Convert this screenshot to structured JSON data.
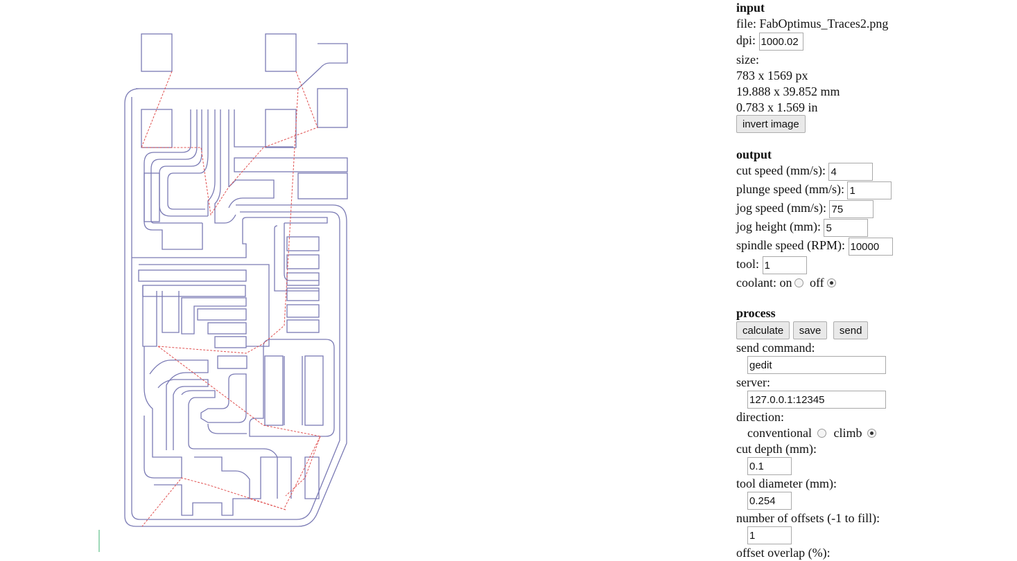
{
  "input": {
    "title": "input",
    "file_label": "file:",
    "file_name": "FabOptimus_Traces2.png",
    "dpi_label": "dpi:",
    "dpi_value": "1000.02",
    "size_label": "size:",
    "size_px": "783 x 1569 px",
    "size_mm": "19.888 x 39.852 mm",
    "size_in": "0.783 x 1.569 in",
    "invert_label": "invert image"
  },
  "output": {
    "title": "output",
    "cut_speed_label": "cut speed (mm/s):",
    "cut_speed": "4",
    "plunge_speed_label": "plunge speed (mm/s):",
    "plunge_speed": "1",
    "jog_speed_label": "jog speed (mm/s):",
    "jog_speed": "75",
    "jog_height_label": "jog height (mm):",
    "jog_height": "5",
    "spindle_label": "spindle speed (RPM):",
    "spindle": "10000",
    "tool_label": "tool:",
    "tool": "1",
    "coolant_label": "coolant:",
    "coolant_on": "on",
    "coolant_off": "off",
    "coolant_selected": "off"
  },
  "process": {
    "title": "process",
    "calculate_label": "calculate",
    "save_label": "save",
    "send_label": "send",
    "send_command_label": "send command:",
    "send_command": "gedit",
    "server_label": "server:",
    "server": "127.0.0.1:12345",
    "direction_label": "direction:",
    "dir_conventional": "conventional",
    "dir_climb": "climb",
    "direction_selected": "climb",
    "cut_depth_label": "cut depth (mm):",
    "cut_depth": "0.1",
    "tool_diameter_label": "tool diameter (mm):",
    "tool_diameter": "0.254",
    "offsets_label": "number of offsets (-1 to fill):",
    "offsets": "1",
    "offset_overlap_label": "offset overlap (%):"
  },
  "colors": {
    "toolpath": "#7a7ab4",
    "jog": "#e05050"
  }
}
